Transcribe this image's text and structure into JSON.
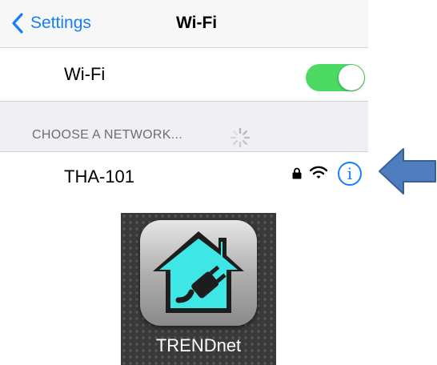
{
  "navbar": {
    "back_label": "Settings",
    "title": "Wi-Fi"
  },
  "wifi_toggle": {
    "label": "Wi-Fi",
    "state": "on",
    "color": "#4cd964"
  },
  "networks_section": {
    "header": "CHOOSE A NETWORK...",
    "loading": true
  },
  "networks": [
    {
      "name": "THA-101",
      "secured": true,
      "icons": [
        "lock-icon",
        "wifi-signal-icon",
        "info-icon"
      ]
    }
  ],
  "callout": {
    "icon": "arrow-left-icon",
    "color": "#4f7ec0"
  },
  "app": {
    "name": "TRENDnet",
    "icon": "house-plug-icon",
    "accent": "#3ee6e6"
  },
  "colors": {
    "ios_blue": "#157efb",
    "navbar_bg": "#f7f7f7",
    "section_bg": "#efeff4"
  }
}
